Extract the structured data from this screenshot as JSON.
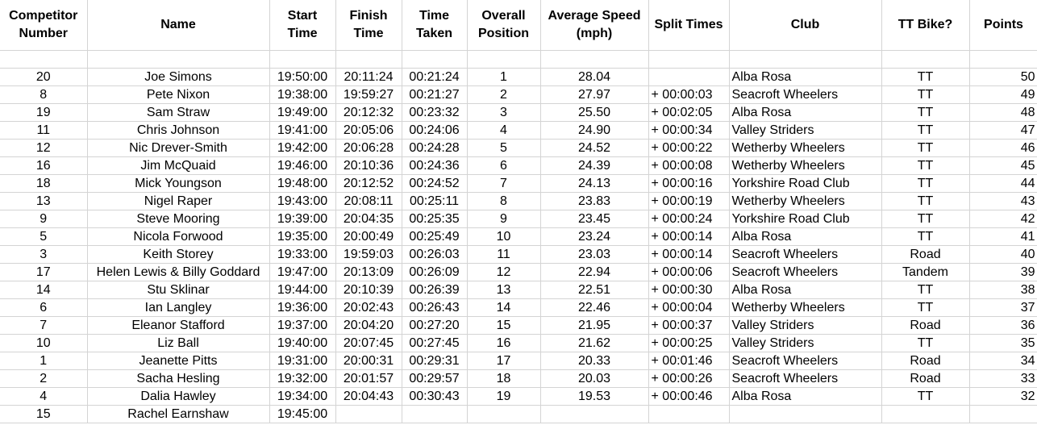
{
  "headers": [
    {
      "line1": "Competitor",
      "line2": "Number"
    },
    {
      "line1": "Name",
      "line2": ""
    },
    {
      "line1": "Start",
      "line2": "Time"
    },
    {
      "line1": "Finish",
      "line2": "Time"
    },
    {
      "line1": "Time",
      "line2": "Taken"
    },
    {
      "line1": "Overall",
      "line2": "Position"
    },
    {
      "line1": "Average Speed",
      "line2": "(mph)"
    },
    {
      "line1": "Split Times",
      "line2": ""
    },
    {
      "line1": "Club",
      "line2": ""
    },
    {
      "line1": "TT Bike?",
      "line2": ""
    },
    {
      "line1": "Points",
      "line2": ""
    }
  ],
  "rows": [
    {
      "number": "20",
      "name": "Joe Simons",
      "start": "19:50:00",
      "finish": "20:11:24",
      "taken": "00:21:24",
      "position": "1",
      "speed": "28.04",
      "split": "",
      "club": "Alba Rosa",
      "bike": "TT",
      "points": "50"
    },
    {
      "number": "8",
      "name": "Pete Nixon",
      "start": "19:38:00",
      "finish": "19:59:27",
      "taken": "00:21:27",
      "position": "2",
      "speed": "27.97",
      "split": "+ 00:00:03",
      "club": "Seacroft Wheelers",
      "bike": "TT",
      "points": "49"
    },
    {
      "number": "19",
      "name": "Sam Straw",
      "start": "19:49:00",
      "finish": "20:12:32",
      "taken": "00:23:32",
      "position": "3",
      "speed": "25.50",
      "split": "+ 00:02:05",
      "club": "Alba Rosa",
      "bike": "TT",
      "points": "48"
    },
    {
      "number": "11",
      "name": "Chris Johnson",
      "start": "19:41:00",
      "finish": "20:05:06",
      "taken": "00:24:06",
      "position": "4",
      "speed": "24.90",
      "split": "+ 00:00:34",
      "club": "Valley Striders",
      "bike": "TT",
      "points": "47"
    },
    {
      "number": "12",
      "name": "Nic Drever-Smith",
      "start": "19:42:00",
      "finish": "20:06:28",
      "taken": "00:24:28",
      "position": "5",
      "speed": "24.52",
      "split": "+ 00:00:22",
      "club": "Wetherby Wheelers",
      "bike": "TT",
      "points": "46"
    },
    {
      "number": "16",
      "name": "Jim McQuaid",
      "start": "19:46:00",
      "finish": "20:10:36",
      "taken": "00:24:36",
      "position": "6",
      "speed": "24.39",
      "split": "+ 00:00:08",
      "club": "Wetherby Wheelers",
      "bike": "TT",
      "points": "45"
    },
    {
      "number": "18",
      "name": "Mick Youngson",
      "start": "19:48:00",
      "finish": "20:12:52",
      "taken": "00:24:52",
      "position": "7",
      "speed": "24.13",
      "split": "+ 00:00:16",
      "club": "Yorkshire Road Club",
      "bike": "TT",
      "points": "44"
    },
    {
      "number": "13",
      "name": "Nigel Raper",
      "start": "19:43:00",
      "finish": "20:08:11",
      "taken": "00:25:11",
      "position": "8",
      "speed": "23.83",
      "split": "+ 00:00:19",
      "club": "Wetherby Wheelers",
      "bike": "TT",
      "points": "43"
    },
    {
      "number": "9",
      "name": "Steve Mooring",
      "start": "19:39:00",
      "finish": "20:04:35",
      "taken": "00:25:35",
      "position": "9",
      "speed": "23.45",
      "split": "+ 00:00:24",
      "club": "Yorkshire Road Club",
      "bike": "TT",
      "points": "42"
    },
    {
      "number": "5",
      "name": "Nicola Forwood",
      "start": "19:35:00",
      "finish": "20:00:49",
      "taken": "00:25:49",
      "position": "10",
      "speed": "23.24",
      "split": "+ 00:00:14",
      "club": "Alba Rosa",
      "bike": "TT",
      "points": "41"
    },
    {
      "number": "3",
      "name": "Keith Storey",
      "start": "19:33:00",
      "finish": "19:59:03",
      "taken": "00:26:03",
      "position": "11",
      "speed": "23.03",
      "split": "+ 00:00:14",
      "club": "Seacroft Wheelers",
      "bike": "Road",
      "points": "40"
    },
    {
      "number": "17",
      "name": "Helen Lewis & Billy Goddard",
      "start": "19:47:00",
      "finish": "20:13:09",
      "taken": "00:26:09",
      "position": "12",
      "speed": "22.94",
      "split": "+ 00:00:06",
      "club": "Seacroft Wheelers",
      "bike": "Tandem",
      "points": "39"
    },
    {
      "number": "14",
      "name": "Stu Sklinar",
      "start": "19:44:00",
      "finish": "20:10:39",
      "taken": "00:26:39",
      "position": "13",
      "speed": "22.51",
      "split": "+ 00:00:30",
      "club": "Alba Rosa",
      "bike": "TT",
      "points": "38"
    },
    {
      "number": "6",
      "name": "Ian Langley",
      "start": "19:36:00",
      "finish": "20:02:43",
      "taken": "00:26:43",
      "position": "14",
      "speed": "22.46",
      "split": "+ 00:00:04",
      "club": "Wetherby Wheelers",
      "bike": "TT",
      "points": "37"
    },
    {
      "number": "7",
      "name": "Eleanor Stafford",
      "start": "19:37:00",
      "finish": "20:04:20",
      "taken": "00:27:20",
      "position": "15",
      "speed": "21.95",
      "split": "+ 00:00:37",
      "club": "Valley Striders",
      "bike": "Road",
      "points": "36"
    },
    {
      "number": "10",
      "name": "Liz Ball",
      "start": "19:40:00",
      "finish": "20:07:45",
      "taken": "00:27:45",
      "position": "16",
      "speed": "21.62",
      "split": "+ 00:00:25",
      "club": "Valley Striders",
      "bike": "TT",
      "points": "35"
    },
    {
      "number": "1",
      "name": "Jeanette Pitts",
      "start": "19:31:00",
      "finish": "20:00:31",
      "taken": "00:29:31",
      "position": "17",
      "speed": "20.33",
      "split": "+ 00:01:46",
      "club": "Seacroft Wheelers",
      "bike": "Road",
      "points": "34"
    },
    {
      "number": "2",
      "name": "Sacha Hesling",
      "start": "19:32:00",
      "finish": "20:01:57",
      "taken": "00:29:57",
      "position": "18",
      "speed": "20.03",
      "split": "+ 00:00:26",
      "club": "Seacroft Wheelers",
      "bike": "Road",
      "points": "33"
    },
    {
      "number": "4",
      "name": "Dalia Hawley",
      "start": "19:34:00",
      "finish": "20:04:43",
      "taken": "00:30:43",
      "position": "19",
      "speed": "19.53",
      "split": "+ 00:00:46",
      "club": "Alba Rosa",
      "bike": "TT",
      "points": "32"
    },
    {
      "number": "15",
      "name": "Rachel Earnshaw",
      "start": "19:45:00",
      "finish": "",
      "taken": "",
      "position": "",
      "speed": "",
      "split": "",
      "club": "",
      "bike": "",
      "points": ""
    }
  ]
}
